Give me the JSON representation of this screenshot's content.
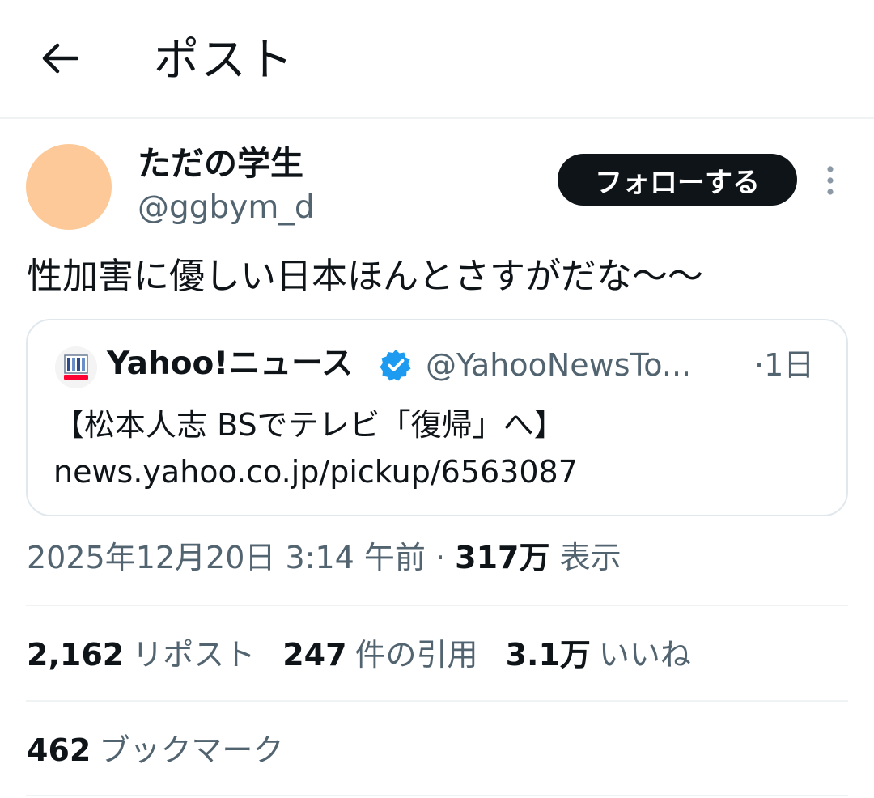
{
  "header": {
    "title": "ポスト",
    "back_icon": "arrow-left-icon"
  },
  "author": {
    "display_name": "ただの学生",
    "handle": "@ggbym_d",
    "avatar_color": "#fdc998"
  },
  "follow_button": {
    "label": "フォローする"
  },
  "more_icon": "more-vertical-icon",
  "tweet": {
    "text": "性加害に優しい日本ほんとさすがだな〜〜"
  },
  "quote": {
    "author": "Yahoo!ニュース",
    "verified_icon": "verified-badge-icon",
    "handle": "@YahooNewsTo...",
    "time": "·1日",
    "line1": "【松本人志 BSでテレビ「復帰」へ】",
    "line2": "news.yahoo.co.jp/pickup/6563087"
  },
  "meta": {
    "timestamp": "2025年12月20日 3:14 午前",
    "separator": " · ",
    "views_count": "317万",
    "views_label": " 表示"
  },
  "stats": {
    "reposts_count": "2,162",
    "reposts_label": "リポスト",
    "quotes_count": "247",
    "quotes_label": "件の引用",
    "likes_count": "3.1万",
    "likes_label": "いいね",
    "bookmarks_count": "462",
    "bookmarks_label": "ブックマーク"
  },
  "colors": {
    "text_primary": "#0f1419",
    "text_secondary": "#536471",
    "verified_blue": "#1d9bf0",
    "divider": "#eff3f4"
  }
}
